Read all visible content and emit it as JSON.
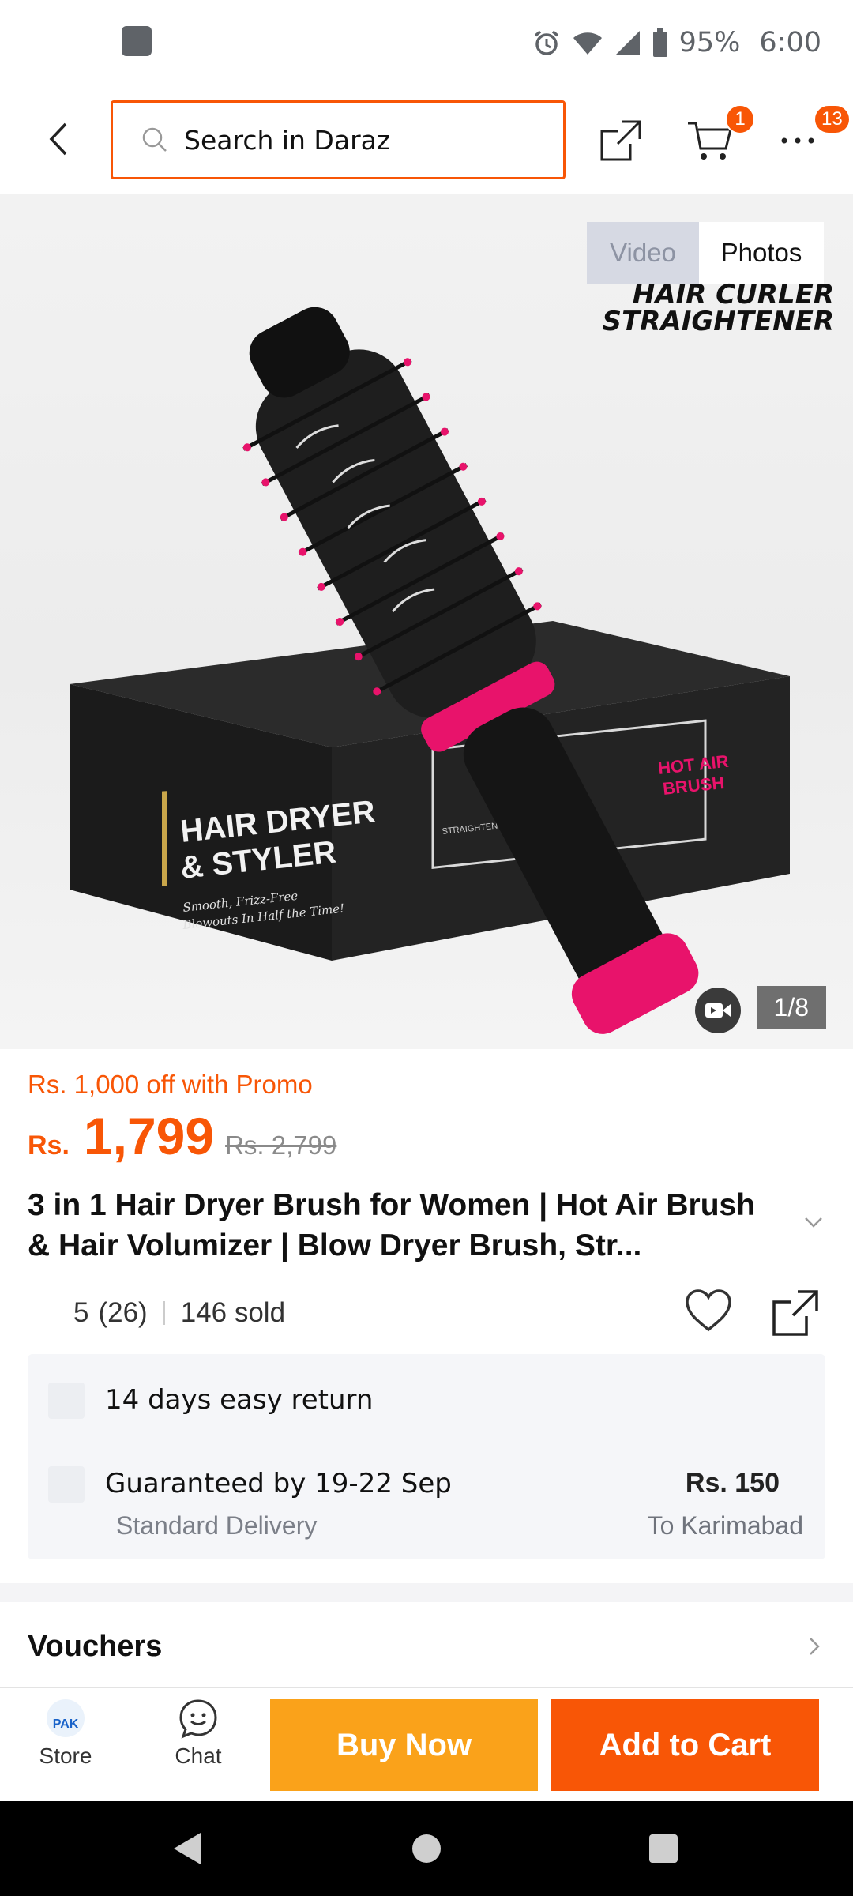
{
  "status_bar": {
    "battery": "95%",
    "time": "6:00",
    "icons": [
      "notification-square-icon",
      "alarm-icon",
      "wifi-icon",
      "signal-icon",
      "battery-icon"
    ]
  },
  "header": {
    "search_placeholder": "Search in Daraz",
    "cart_badge": "1",
    "more_badge": "13"
  },
  "gallery": {
    "tabs": {
      "video": "Video",
      "photos": "Photos"
    },
    "counter": "1/8",
    "image_text": [
      "HAIR CURLER",
      "STRAIGHTENER"
    ],
    "box_text": [
      "HAIR DRYER",
      "& STYLER",
      "Smooth, Frizz-Free",
      "Blowouts In Half the Time!",
      "HOT AIR",
      "BRUSH",
      "STRAIGHTENING"
    ]
  },
  "price": {
    "promo": "Rs. 1,000 off with Promo",
    "currency": "Rs.",
    "value": "1,799",
    "original": "Rs. 2,799"
  },
  "product": {
    "title": "3 in 1 Hair Dryer Brush for Women | Hot Air Brush & Hair Volumizer | Blow Dryer Brush, Str...",
    "rating": "5",
    "reviews": "(26)",
    "sold": "146 sold"
  },
  "service": {
    "return": "14 days easy return",
    "delivery_title": "Guaranteed by 19-22 Sep",
    "delivery_type": "Standard Delivery",
    "fee": "Rs. 150",
    "location": "To Karimabad"
  },
  "vouchers": {
    "label": "Vouchers"
  },
  "bottom_bar": {
    "store": "Store",
    "store_logo": "PAK",
    "chat": "Chat",
    "buy_now": "Buy Now",
    "add_to_cart": "Add to Cart"
  },
  "colors": {
    "accent": "#f85606",
    "buy_now": "#faa21a",
    "brush_pink": "#e8136b"
  }
}
